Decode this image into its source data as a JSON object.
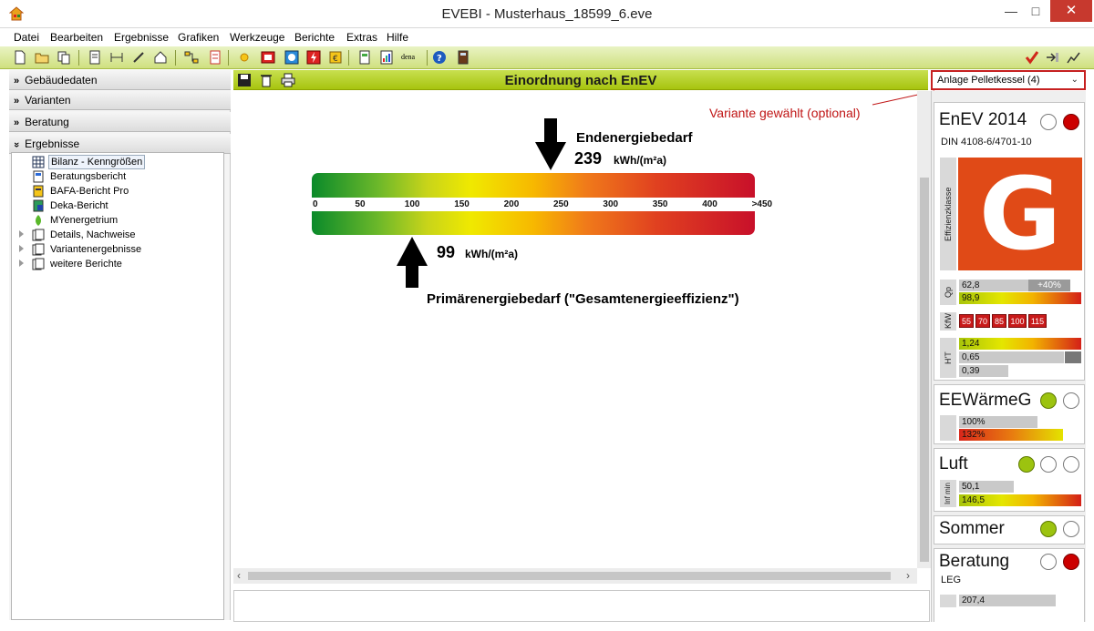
{
  "window": {
    "title": "EVEBI - Musterhaus_18599_6.eve"
  },
  "menu": [
    "Datei",
    "Bearbeiten",
    "Ergebnisse",
    "Grafiken",
    "Werkzeuge",
    "Berichte",
    "Extras",
    "Hilfe"
  ],
  "toolbar": {
    "dena_label": "dena"
  },
  "left_panel": {
    "sections": [
      "Gebäudedaten",
      "Varianten",
      "Beratung",
      "Ergebnisse"
    ],
    "tree": [
      "Bilanz - Kenngrößen",
      "Beratungsbericht",
      "BAFA-Bericht Pro",
      "Deka-Bericht",
      "MYenergetrium",
      "Details, Nachweise",
      "Variantenergebnisse",
      "weitere Berichte"
    ]
  },
  "center": {
    "title": "Einordnung nach EnEV",
    "end_label": "Endenergiebedarf",
    "end_value": "239",
    "end_unit": "kWh/(m²a)",
    "primary_value": "99",
    "primary_unit": "kWh/(m²a)",
    "primary_label": "Primärenergiebedarf (\"Gesamtenergieeffizienz\")",
    "end_value_num": 239,
    "primary_value_num": 99,
    "scale_max": 450,
    "ticks": [
      "0",
      "50",
      "100",
      "150",
      "200",
      "250",
      "300",
      "350",
      "400",
      ">450"
    ]
  },
  "variant": {
    "selected": "Anlage Pelletkessel (4)",
    "note": "Variante gewählt (optional)"
  },
  "right_panel": {
    "enev": {
      "title": "EnEV 2014",
      "subtitle": "DIN 4108-6/4701-10",
      "efficiency_label": "Effizienzklasse",
      "class": "G",
      "class_color": "#e04a17",
      "qp_label": "Qp",
      "qp_value1": "62,8",
      "qp_pct": "+40%",
      "qp_value2": "98,9",
      "kw_label": "KfW",
      "kw_values": [
        "55",
        "70",
        "85",
        "100",
        "115"
      ],
      "ht_label": "H'T",
      "ht_values": [
        "1,24",
        "0,65",
        "0,39"
      ]
    },
    "ee": {
      "title": "EEWärmeG",
      "v1": "100%",
      "v2": "132%"
    },
    "luft": {
      "title": "Luft",
      "side": "Inf min",
      "v1": "50,1",
      "v2": "146,5"
    },
    "sommer": {
      "title": "Sommer"
    },
    "beratung": {
      "title": "Beratung",
      "subtitle": "LEG",
      "v1": "207,4"
    }
  }
}
